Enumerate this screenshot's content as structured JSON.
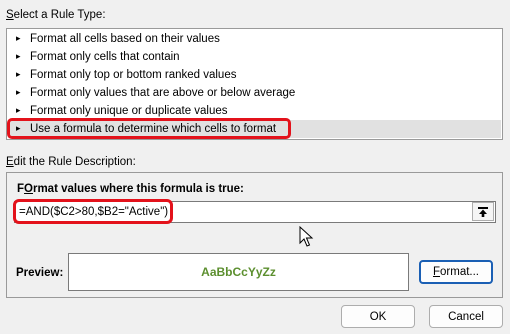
{
  "select_rule": {
    "label_accel": "S",
    "label_rest": "elect a Rule Type:",
    "items": [
      {
        "label": "Format all cells based on their values"
      },
      {
        "label": "Format only cells that contain"
      },
      {
        "label": "Format only top or bottom ranked values"
      },
      {
        "label": "Format only values that are above or below average"
      },
      {
        "label": "Format only unique or duplicate values"
      },
      {
        "label": "Use a formula to determine which cells to format",
        "selected": true
      }
    ]
  },
  "edit_rule": {
    "label_accel": "E",
    "label_rest": "dit the Rule Description:",
    "formula_title_accel": "O",
    "formula_title_pre": "F",
    "formula_title_rest": "rmat values where this formula is true:",
    "formula_value": "=AND($C2>80,$B2=\"Active\")",
    "preview_label": "Preview:",
    "preview_sample": "AaBbCcYyZz",
    "format_button_accel": "F",
    "format_button_rest": "ormat..."
  },
  "footer": {
    "ok_label": "OK",
    "cancel_label": "Cancel"
  },
  "colors": {
    "highlight": "#e3121b",
    "preview_text": "#5c8f2f",
    "focus_border": "#1a5fb4"
  },
  "icons": [
    "rule-arrow-icon",
    "collapse-dialog-icon",
    "mouse-cursor-icon"
  ]
}
